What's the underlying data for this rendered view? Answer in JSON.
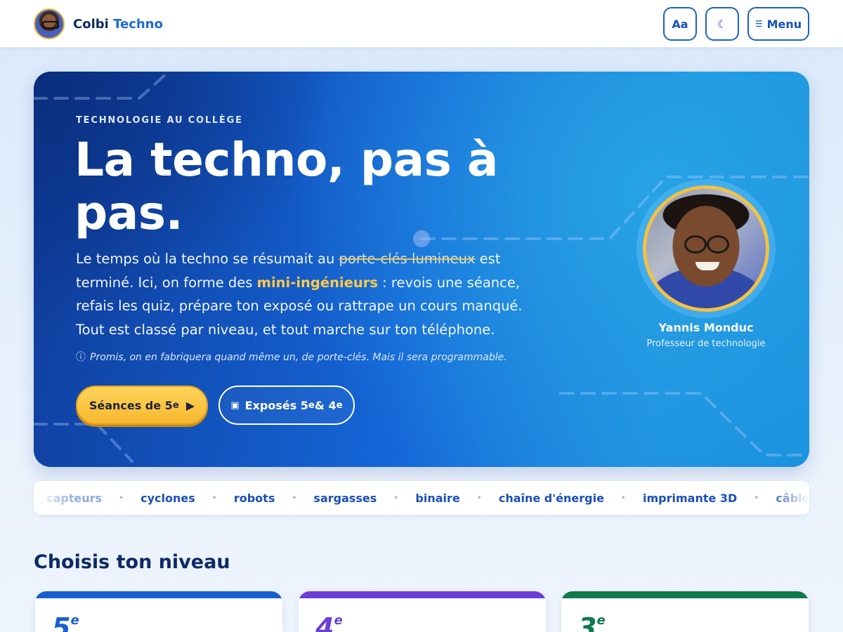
{
  "header": {
    "brand_name_1": "Colbi",
    "brand_name_2": "Techno",
    "font_button_label": "Aa",
    "theme_button_icon": "moon-icon",
    "menu_button_label": "Menu",
    "menu_button_icon": "menu-icon"
  },
  "hero": {
    "eyebrow": "TECHNOLOGIE AU COLLÈGE",
    "title": "La techno, pas à pas.",
    "text_part1": "Le temps où la techno se résumait au ",
    "text_strike": "porte-clés lumineux",
    "text_part2": " est terminé. Ici, on forme des ",
    "text_highlight": "mini-ingénieurs",
    "text_part3": " : revois une séance, refais les quiz, prépare ton exposé ou rattrape un cours manqué. Tout est classé par niveau, et tout marche sur ton téléphone.",
    "note_icon": "info-icon",
    "note": "Promis, on en fabriquera quand même un, de porte-clés. Mais il sera programmable.",
    "cta_primary_label": "Séances de 5",
    "cta_primary_sup": "e",
    "cta_secondary_icon": "presentation-icon",
    "cta_secondary_label_a": "Exposés 5",
    "cta_secondary_sup_a": "e",
    "cta_secondary_mid": " & 4",
    "cta_secondary_sup_b": "e",
    "teacher_name": "Yannis Monduc",
    "teacher_role": "Professeur de technologie"
  },
  "tags": [
    "capteurs",
    "cyclones",
    "robots",
    "sargasses",
    "binaire",
    "chaîne d'énergie",
    "imprimante 3D",
    "câbles sous-ma"
  ],
  "levels": {
    "title": "Choisis ton niveau",
    "cards": [
      {
        "num": "5",
        "sup": "e",
        "color": "#1a5fd0"
      },
      {
        "num": "4",
        "sup": "e",
        "color": "#6a3fd6"
      },
      {
        "num": "3",
        "sup": "e",
        "color": "#0f7a4d"
      }
    ]
  },
  "colors": {
    "brand_blue": "#1a6ad6",
    "navy": "#0c2a66",
    "yellow": "#f7b82f"
  }
}
